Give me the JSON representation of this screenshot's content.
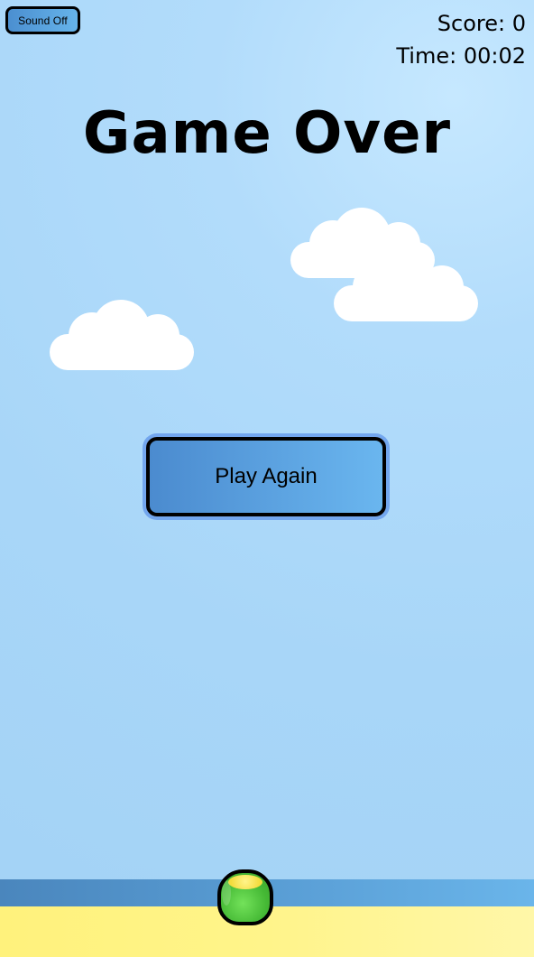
{
  "controls": {
    "sound_button": "Sound Off"
  },
  "hud": {
    "score": "Score: 0",
    "time": "Time: 00:02"
  },
  "game": {
    "title": "Game Over",
    "play_again": "Play Again"
  },
  "colors": {
    "sky": "#a8d6f8",
    "button_blue": "#5fa7e2",
    "water": "#5a9fd6",
    "sand": "#fff48a",
    "player_green": "#45b935",
    "player_top": "#f3dc3e"
  },
  "icons": {
    "cloud": "cloud-icon",
    "player": "player-icon"
  }
}
